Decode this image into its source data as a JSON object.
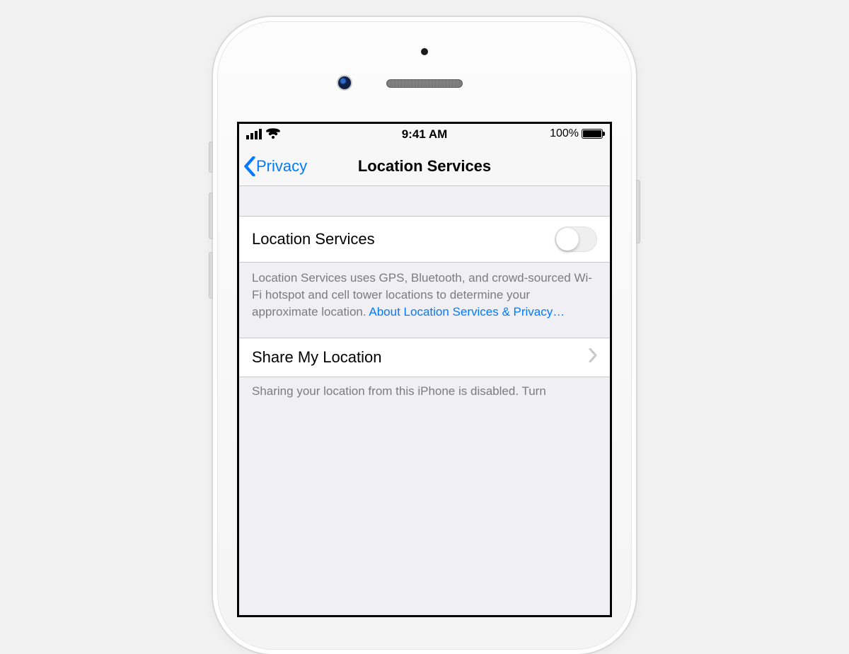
{
  "statusbar": {
    "time": "9:41 AM",
    "battery_pct": "100%"
  },
  "nav": {
    "back_label": "Privacy",
    "title": "Location Services"
  },
  "rows": {
    "location_services_label": "Location Services",
    "location_services_on": false,
    "location_services_footer": "Location Services uses GPS, Bluetooth, and crowd-sourced Wi-Fi hotspot and cell tower locations to determine your approximate location. ",
    "location_services_footer_link": "About Location Services & Privacy…",
    "share_my_location_label": "Share My Location",
    "share_footer": "Sharing your location from this iPhone is disabled. Turn"
  }
}
